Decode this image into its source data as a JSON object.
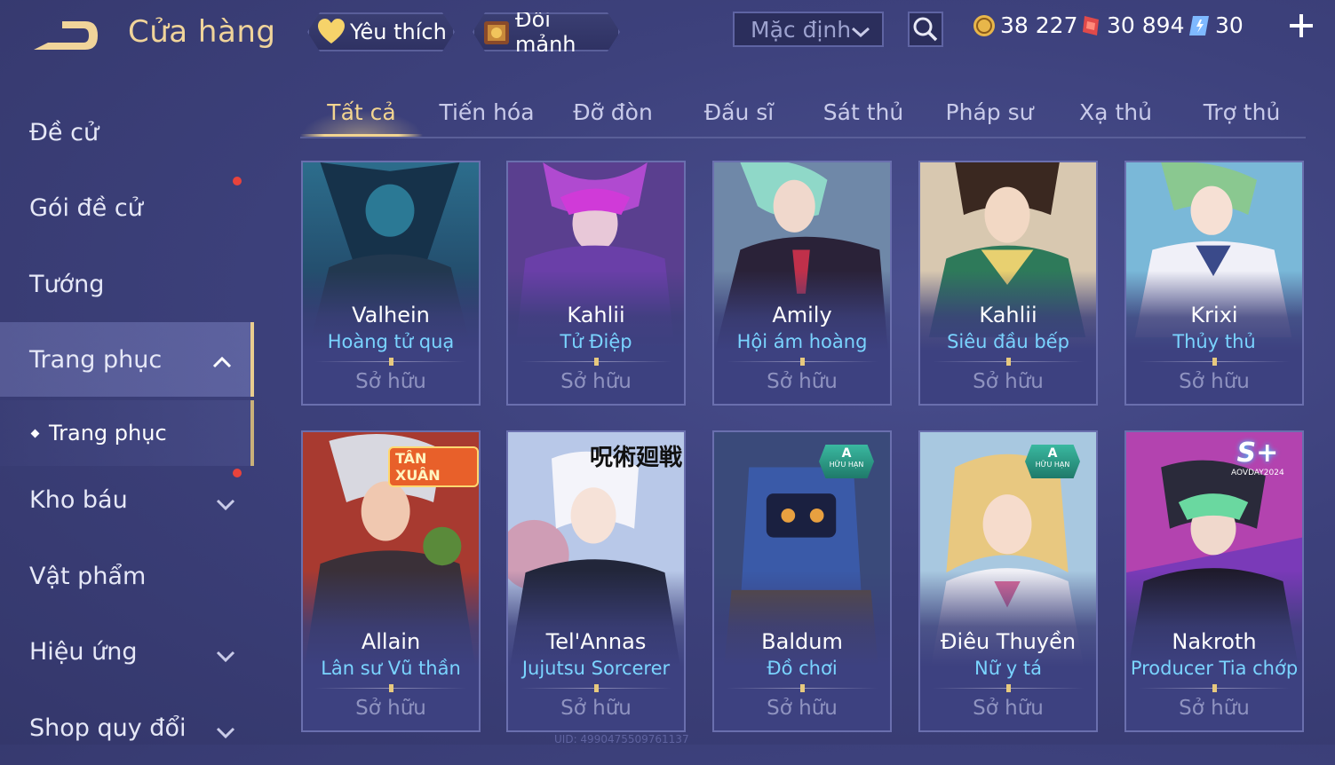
{
  "header": {
    "title": "Cửa hàng",
    "favorites_label": "Yêu thích",
    "exchange_label": "Đổi mảnh",
    "sort_value": "Mặc định",
    "currencies": [
      {
        "name": "gold-coin",
        "value": "38 227",
        "color": "#e8b64a"
      },
      {
        "name": "red-voucher",
        "value": "30 894",
        "color": "#e04a4a"
      },
      {
        "name": "crystal",
        "value": "30",
        "color": "#7fb9ff"
      }
    ]
  },
  "sidebar": {
    "items": [
      {
        "label": "Đề cử"
      },
      {
        "label": "Gói đề cử"
      },
      {
        "label": "Tướng"
      },
      {
        "label": "Trang phục"
      },
      {
        "label": "Kho báu"
      },
      {
        "label": "Vật phẩm"
      },
      {
        "label": "Hiệu ứng"
      },
      {
        "label": "Shop quy đổi"
      }
    ],
    "sub_item": "Trang phục"
  },
  "tabs": [
    {
      "label": "Tất cả"
    },
    {
      "label": "Tiến hóa"
    },
    {
      "label": "Đỡ đòn"
    },
    {
      "label": "Đấu sĩ"
    },
    {
      "label": "Sát thủ"
    },
    {
      "label": "Pháp sư"
    },
    {
      "label": "Xạ thủ"
    },
    {
      "label": "Trợ thủ"
    }
  ],
  "skins": [
    {
      "hero": "Valhein",
      "skin": "Hoàng tử quạ",
      "status": "Sở hữu"
    },
    {
      "hero": "Kahlii",
      "skin": "Tử Điệp",
      "status": "Sở hữu"
    },
    {
      "hero": "Amily",
      "skin": "Hội ám hoàng",
      "status": "Sở hữu"
    },
    {
      "hero": "Kahlii",
      "skin": "Siêu đầu bếp",
      "status": "Sở hữu"
    },
    {
      "hero": "Krixi",
      "skin": "Thủy thủ",
      "status": "Sở hữu"
    },
    {
      "hero": "Allain",
      "skin": "Lân sư Vũ thần",
      "status": "Sở hữu",
      "badge": "TÂN XUÂN"
    },
    {
      "hero": "Tel'Annas",
      "skin": "Jujutsu Sorcerer",
      "status": "Sở hữu",
      "badge": "呪術廻戦"
    },
    {
      "hero": "Baldum",
      "skin": "Đồ chơi",
      "status": "Sở hữu",
      "badge_tier": "A",
      "badge_sub": "HỮU HẠN"
    },
    {
      "hero": "Điêu Thuyền",
      "skin": "Nữ y tá",
      "status": "Sở hữu",
      "badge_tier": "A",
      "badge_sub": "HỮU HẠN"
    },
    {
      "hero": "Nakroth",
      "skin": "Producer Tia chớp",
      "status": "Sở hữu",
      "badge": "S+",
      "badge_sub": "AOVDAY2024"
    }
  ],
  "footer": {
    "uid": "UID: 4990475509761137"
  }
}
